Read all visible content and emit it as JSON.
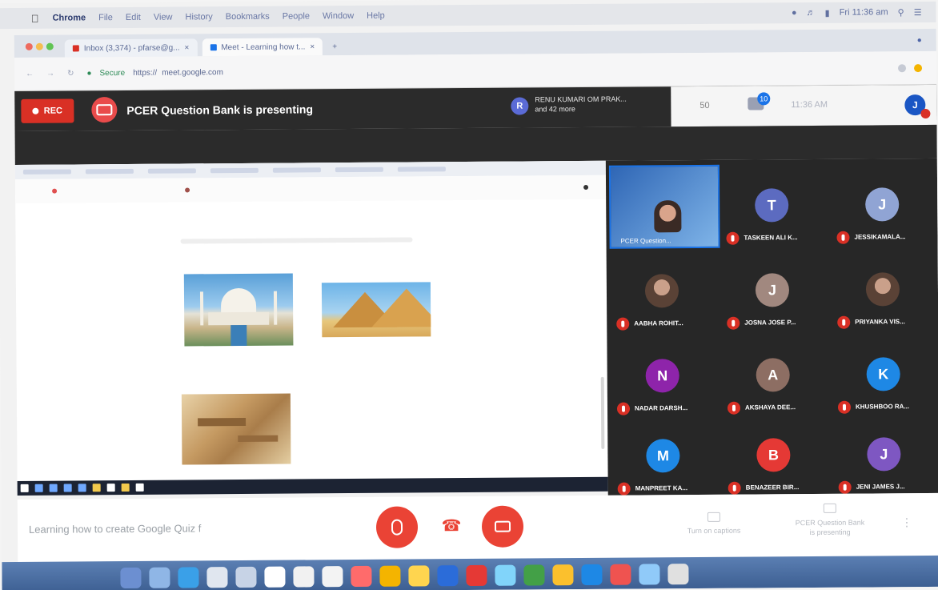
{
  "menubar": {
    "app": "Chrome",
    "items": [
      "File",
      "Edit",
      "View",
      "History",
      "Bookmarks",
      "People",
      "Window",
      "Help"
    ],
    "clock": "Fri 11:36 am"
  },
  "browser": {
    "tabs": [
      {
        "label": "Inbox (3,374) - pfarse@g...",
        "icon_color": "#d93025"
      },
      {
        "label": "Meet - Learning how t...",
        "icon_color": "#1a73e8"
      }
    ],
    "secure_label": "Secure",
    "url_scheme": "https://",
    "url": "meet.google.com"
  },
  "meet": {
    "rec_label": "REC",
    "presenting_text": "PCER Question Bank is presenting",
    "viewer_initial": "R",
    "viewer_line1": "RENU KUMARI OM PRAK...",
    "viewer_line2": "and 42 more",
    "people_count": "50",
    "chat_badge": "10",
    "time": "11:36 AM",
    "user_initial": "J"
  },
  "participants": [
    {
      "name": "PCER Question...",
      "initial": "",
      "color": "#2f66b5",
      "presenter": true
    },
    {
      "name": "TASKEEN ALI K...",
      "initial": "T",
      "color": "#5c6bc0"
    },
    {
      "name": "JESSIKAMALA...",
      "initial": "J",
      "color": "#90a4d4"
    },
    {
      "name": "AABHA ROHIT...",
      "initial": "",
      "color": "#8d6e63",
      "photo": true
    },
    {
      "name": "JOSNA JOSE P...",
      "initial": "J",
      "color": "#a1887f"
    },
    {
      "name": "PRIYANKA VIS...",
      "initial": "",
      "color": "#6d4c41",
      "photo": true
    },
    {
      "name": "NADAR DARSH...",
      "initial": "N",
      "color": "#8e24aa"
    },
    {
      "name": "AKSHAYA DEE...",
      "initial": "A",
      "color": "#8d6e63"
    },
    {
      "name": "KHUSHBOO RA...",
      "initial": "K",
      "color": "#1e88e5"
    },
    {
      "name": "MANPREET KA...",
      "initial": "M",
      "color": "#1e88e5"
    },
    {
      "name": "BENAZEER BIR...",
      "initial": "B",
      "color": "#e53935"
    },
    {
      "name": "JENI JAMES J...",
      "initial": "J",
      "color": "#7e57c2"
    }
  ],
  "controls": {
    "meeting_title": "Learning how to create Google Quiz f",
    "captions_label": "Turn on captions",
    "presenting_label_1": "PCER Question Bank",
    "presenting_label_2": "is presenting",
    "more_label": "⋮"
  },
  "colors": {
    "danger": "#ea4335",
    "meet_dark": "#2b2b2b",
    "accent": "#1a73e8"
  }
}
